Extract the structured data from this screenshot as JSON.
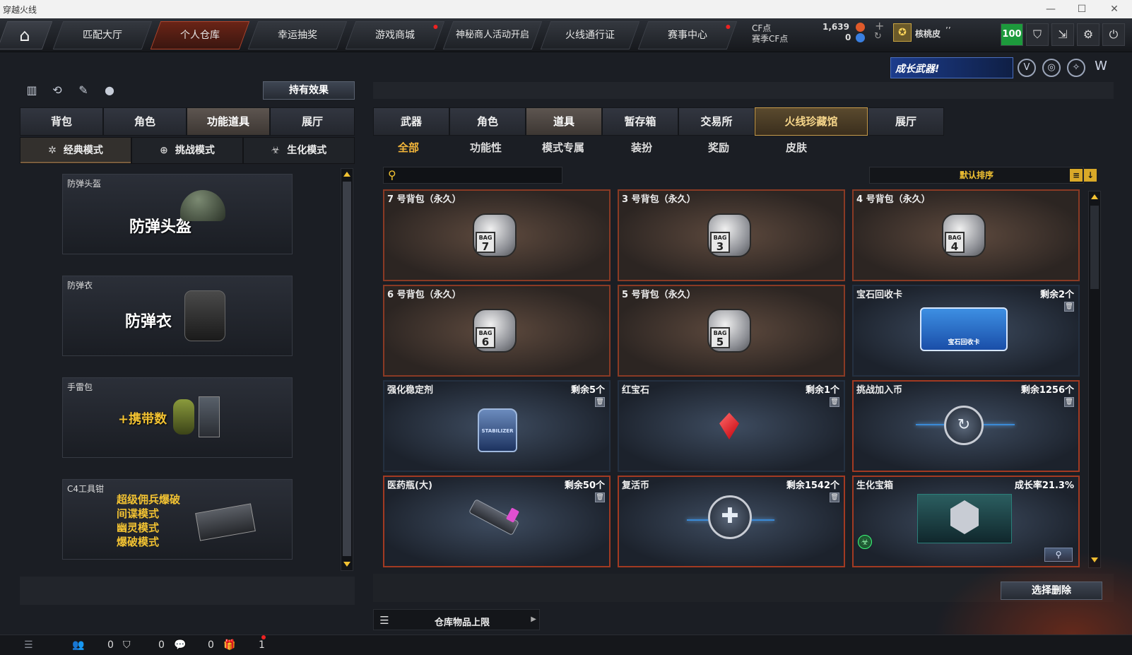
{
  "window": {
    "title": "穿越火线"
  },
  "topnav": {
    "tabs": [
      {
        "label": "匹配大厅"
      },
      {
        "label": "个人仓库"
      },
      {
        "label": "幸运抽奖"
      },
      {
        "label": "游戏商城"
      },
      {
        "label": "神秘商人活动开启"
      },
      {
        "label": "火线通行证"
      },
      {
        "label": "赛事中心"
      }
    ],
    "currency": {
      "cf_label": "CF点",
      "cf_value": "1,639",
      "season_label": "赛季CF点",
      "season_value": "0"
    },
    "user": {
      "name": "核桃皮",
      "suffix": "’’"
    },
    "level_badge": "100"
  },
  "banner": {
    "text": "成长武器!"
  },
  "left": {
    "effects_button": "持有效果",
    "tabs": [
      "背包",
      "角色",
      "功能道具",
      "展厅"
    ],
    "mode_tabs": [
      "经典模式",
      "挑战模式",
      "生化模式"
    ],
    "items": [
      {
        "title": "防弹头盔",
        "big": "防弹头盔"
      },
      {
        "title": "防弹衣",
        "big": "防弹衣"
      },
      {
        "title": "手雷包",
        "big": "+携带数"
      },
      {
        "title": "C4工具钳",
        "lines": [
          "超级佣兵爆破",
          "间谍模式",
          "幽灵模式",
          "爆破模式"
        ]
      }
    ]
  },
  "right": {
    "tabs": [
      "武器",
      "角色",
      "道具",
      "暂存箱",
      "交易所",
      "火线珍藏馆",
      "展厅"
    ],
    "subtabs": [
      "全部",
      "功能性",
      "模式专属",
      "装扮",
      "奖励",
      "皮肤"
    ],
    "sort_label": "默认排序",
    "items": [
      {
        "name": "7 号背包（永久）",
        "bag": "7",
        "bag_text": "BAG"
      },
      {
        "name": "3 号背包（永久）",
        "bag": "3",
        "bag_text": "BAG"
      },
      {
        "name": "4 号背包（永久）",
        "bag": "4",
        "bag_text": "BAG"
      },
      {
        "name": "6 号背包（永久）",
        "bag": "6",
        "bag_text": "BAG"
      },
      {
        "name": "5 号背包（永久）",
        "bag": "5",
        "bag_text": "BAG"
      },
      {
        "name": "宝石回收卡",
        "right": "剩余2个",
        "art": "宝石回收卡"
      },
      {
        "name": "强化稳定剂",
        "right": "剩余5个",
        "art": "STABILIZER"
      },
      {
        "name": "红宝石",
        "right": "剩余1个"
      },
      {
        "name": "挑战加入币",
        "right": "剩余1256个"
      },
      {
        "name": "医药瓶(大)",
        "right": "剩余50个"
      },
      {
        "name": "复活币",
        "right": "剩余1542个"
      },
      {
        "name": "生化宝箱",
        "right": "成长率21.3%"
      }
    ],
    "delete_button": "选择删除",
    "storage_label": "仓库物品上限"
  },
  "statusbar": {
    "counts": [
      "0",
      "0",
      "0",
      "1"
    ]
  }
}
